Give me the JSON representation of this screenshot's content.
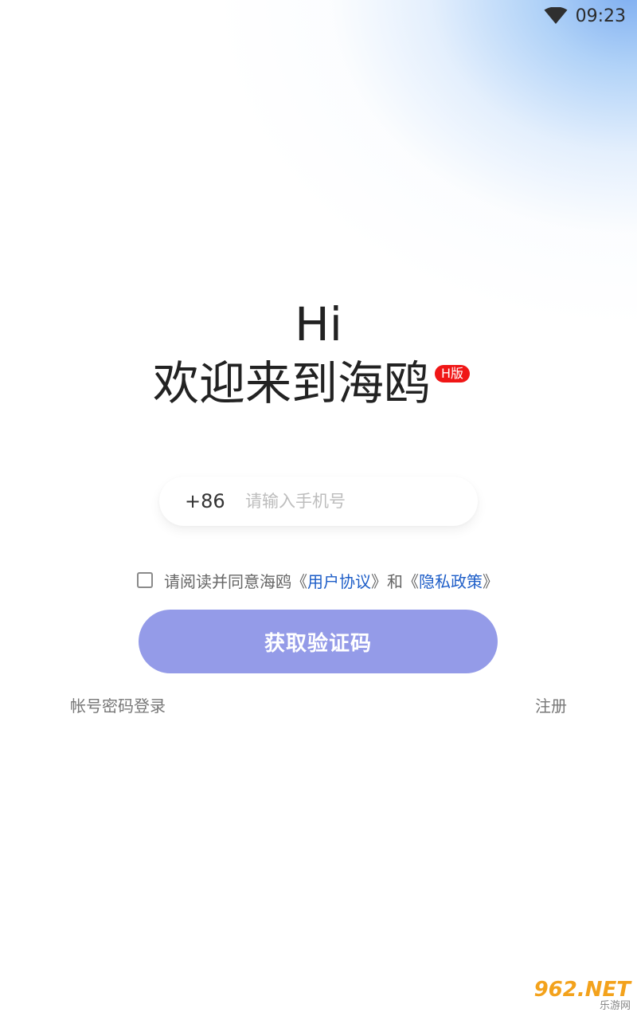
{
  "status_bar": {
    "time": "09:23",
    "wifi_icon": "wifi-icon"
  },
  "greeting": {
    "hi": "Hi",
    "welcome": "欢迎来到海鸥",
    "badge": "H版"
  },
  "phone": {
    "country_code": "+86",
    "placeholder": "请输入手机号",
    "value": ""
  },
  "agreement": {
    "prefix": "请阅读并同意海鸥《",
    "user_agreement": "用户协议",
    "middle": "》和《",
    "privacy_policy": "隐私政策",
    "suffix": "》",
    "checked": false
  },
  "actions": {
    "get_code": "获取验证码",
    "password_login": "帐号密码登录",
    "register": "注册"
  },
  "watermark": {
    "main": "962.NET",
    "sub": "乐游网"
  },
  "colors": {
    "button": "#949be8",
    "link": "#1e5ec8",
    "badge": "#f01616",
    "glow": "#78aaf0"
  }
}
